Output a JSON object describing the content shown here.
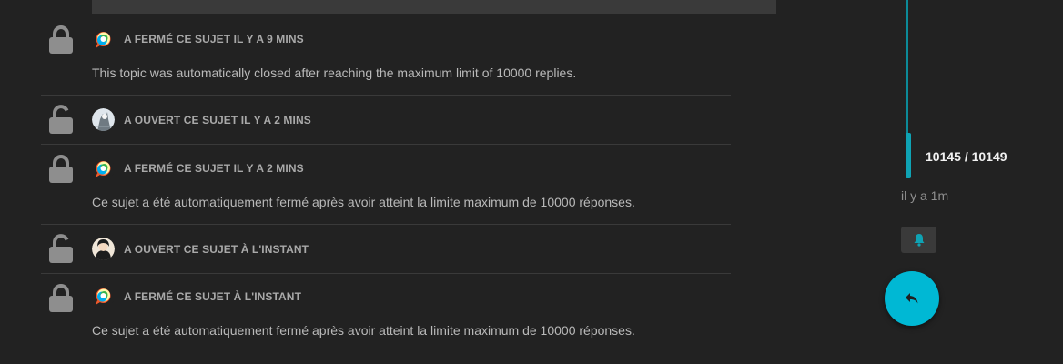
{
  "timeline": {
    "counter": "10145 / 10149",
    "last_activity": "il y a 1m",
    "accent_color": "#0fa3b4",
    "bell_icon": "bell-icon",
    "reply_icon": "reply-arrow-icon"
  },
  "events": [
    {
      "icon": "lock-closed-icon",
      "avatar": "chat-bubble-avatar",
      "action": "A FERMÉ CE SUJET IL Y A 9 MINS",
      "body": "This topic was automatically closed after reaching the maximum limit of 10000 replies."
    },
    {
      "icon": "lock-open-icon",
      "avatar": "user-avatar",
      "action": "A OUVERT CE SUJET IL Y A 2 MINS",
      "body": ""
    },
    {
      "icon": "lock-closed-icon",
      "avatar": "chat-bubble-avatar",
      "action": "A FERMÉ CE SUJET IL Y A 2 MINS",
      "body": "Ce sujet a été automatiquement fermé après avoir atteint la limite maximum de 10000 réponses."
    },
    {
      "icon": "lock-open-icon",
      "avatar": "user-avatar",
      "action": "A OUVERT CE SUJET À L'INSTANT",
      "body": ""
    },
    {
      "icon": "lock-closed-icon",
      "avatar": "chat-bubble-avatar",
      "action": "A FERMÉ CE SUJET À L'INSTANT",
      "body": "Ce sujet a été automatiquement fermé après avoir atteint la limite maximum de 10000 réponses."
    }
  ]
}
